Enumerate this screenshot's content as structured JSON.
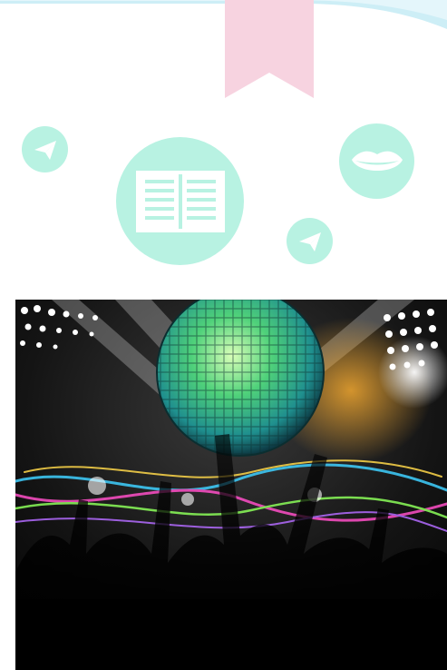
{
  "icons": {
    "bookmark": "bookmark-icon",
    "paper_plane_left": "paper-plane-icon",
    "book": "open-book-icon",
    "lips": "lips-icon",
    "paper_plane_right": "paper-plane-icon"
  },
  "colors": {
    "icon_circle": "#b8f2e2",
    "bookmark": "#f7d3e0",
    "wave": "#cdeef6",
    "icon_glyph": "#ffffff"
  },
  "image": {
    "subject": "disco-ball-party-photo"
  }
}
